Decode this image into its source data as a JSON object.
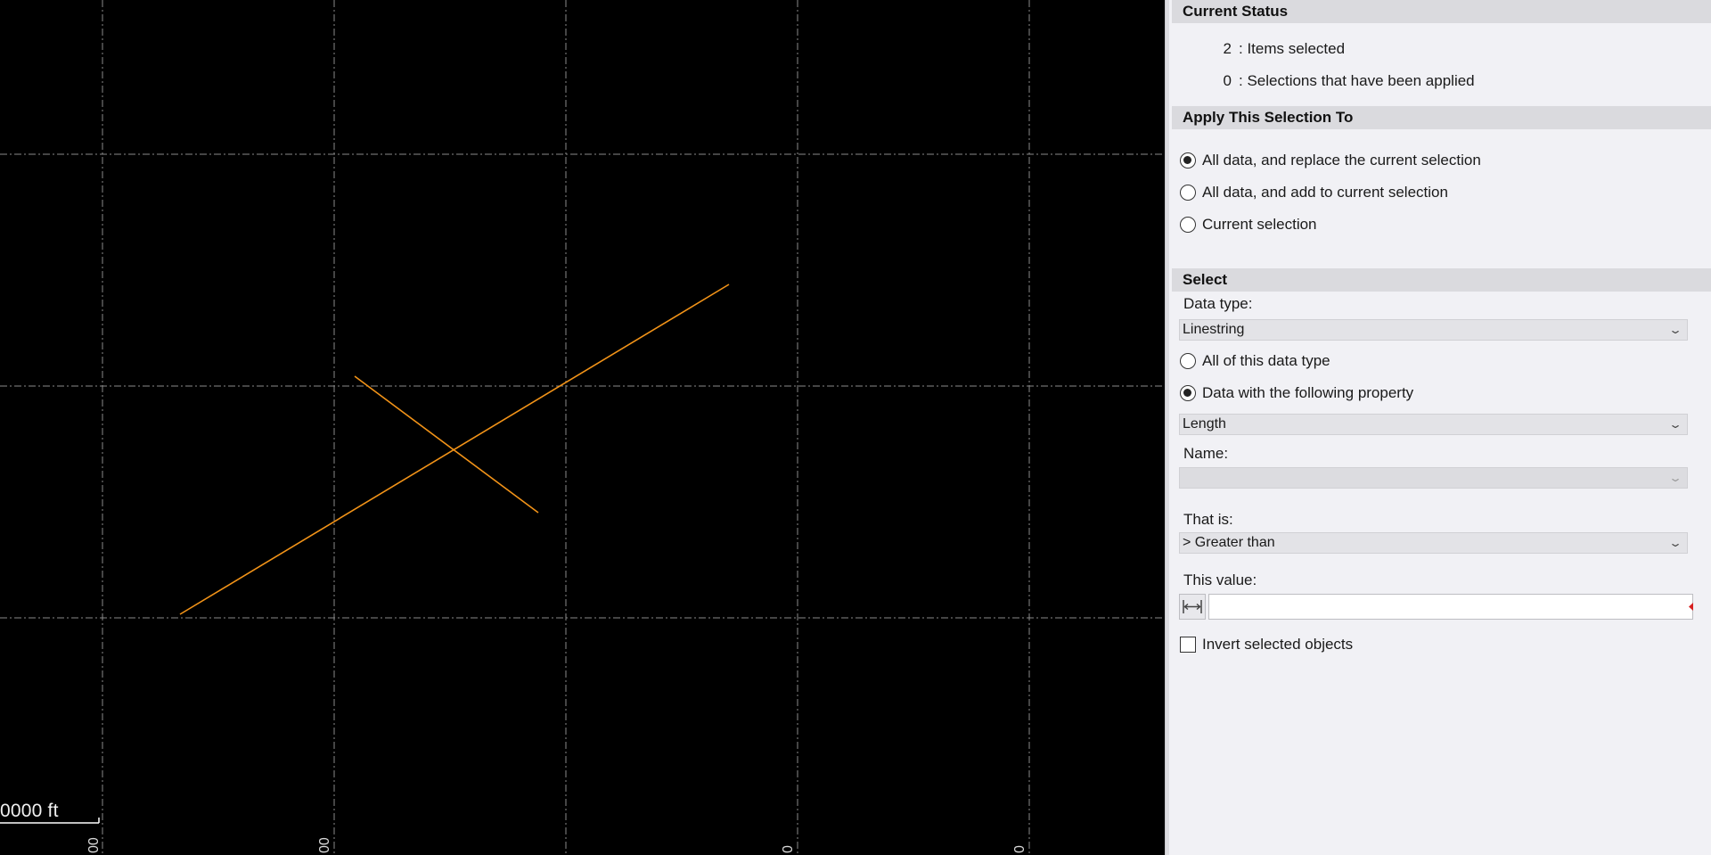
{
  "viewport": {
    "scale_label": "0000 ft",
    "axis_tick_labels": [
      "00",
      "00",
      "0",
      "0"
    ],
    "line_color": "#f29318",
    "grid_color": "#8a8a8a"
  },
  "panel": {
    "current_status": {
      "title": "Current Status",
      "items_selected_count": "2",
      "items_selected_label": ": Items selected",
      "selections_applied_count": "0",
      "selections_applied_label": ": Selections that have been applied"
    },
    "apply_to": {
      "title": "Apply This Selection To",
      "options": [
        {
          "label": "All data, and replace the current selection",
          "checked": true
        },
        {
          "label": "All data, and add to current selection",
          "checked": false
        },
        {
          "label": "Current selection",
          "checked": false
        }
      ]
    },
    "select": {
      "title": "Select",
      "data_type_label": "Data type:",
      "data_type_value": "Linestring",
      "scope_options": [
        {
          "label": "All of this data type",
          "checked": false
        },
        {
          "label": "Data with the following property",
          "checked": true
        }
      ],
      "property_value": "Length",
      "name_label": "Name:",
      "name_value": "",
      "that_is_label": "That is:",
      "that_is_value": "> Greater than",
      "this_value_label": "This value:",
      "this_value": "",
      "invert_label": "Invert selected objects",
      "invert_checked": false
    }
  }
}
